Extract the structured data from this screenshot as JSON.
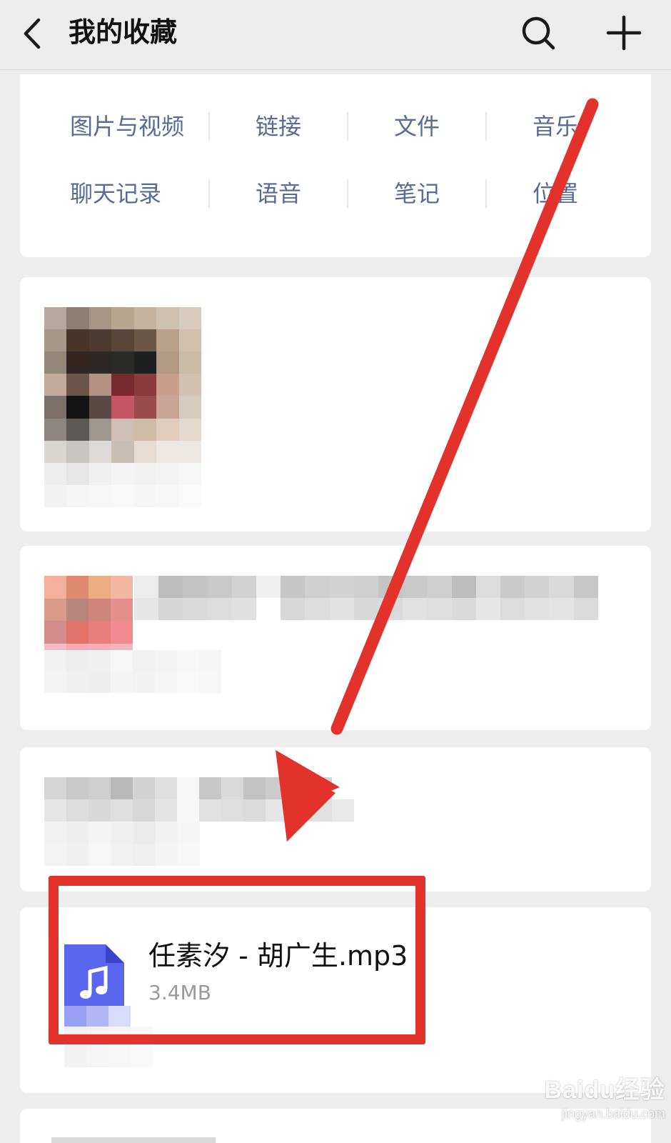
{
  "header": {
    "title": "我的收藏",
    "back_icon": "chevron-left-icon",
    "search_icon": "search-icon",
    "add_icon": "plus-icon"
  },
  "categories": {
    "row1": [
      "图片与视频",
      "链接",
      "文件",
      "音乐"
    ],
    "row2": [
      "聊天记录",
      "语音",
      "笔记",
      "位置"
    ]
  },
  "file_item": {
    "name": "任素汐 - 胡广生.mp3",
    "size": "3.4MB",
    "icon": "music-file-icon"
  },
  "watermark": {
    "brand": "Baidu经验",
    "url": "jingyan.baidu.com"
  },
  "colors": {
    "background": "#ededed",
    "card": "#ffffff",
    "link": "#576b95",
    "annotation": "#e3312b",
    "file_icon": "#5a66f0"
  }
}
